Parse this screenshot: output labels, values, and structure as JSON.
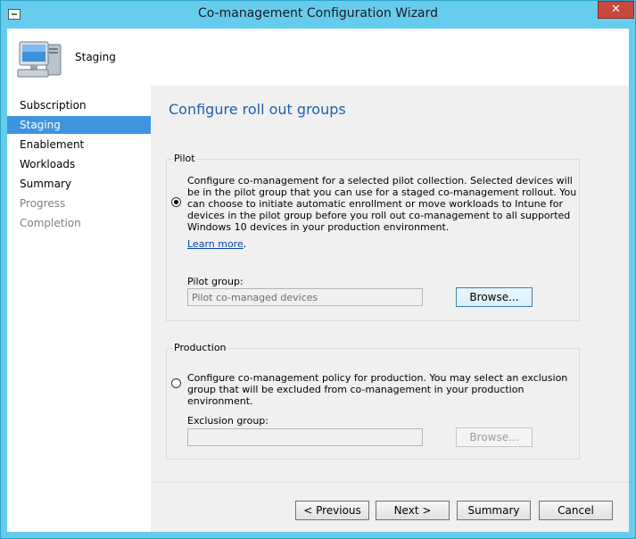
{
  "window": {
    "title": "Co-management Configuration Wizard",
    "close_label": "✕"
  },
  "header": {
    "title": "Staging",
    "icon": "computer-icon"
  },
  "nav": {
    "items": [
      {
        "label": "Subscription",
        "state": "normal"
      },
      {
        "label": "Staging",
        "state": "active"
      },
      {
        "label": "Enablement",
        "state": "normal"
      },
      {
        "label": "Workloads",
        "state": "normal"
      },
      {
        "label": "Summary",
        "state": "normal"
      },
      {
        "label": "Progress",
        "state": "disabled"
      },
      {
        "label": "Completion",
        "state": "disabled"
      }
    ]
  },
  "page": {
    "title": "Configure roll out groups"
  },
  "pilot": {
    "group_label": "Pilot",
    "selected": true,
    "description": "Configure co-management for a selected pilot collection. Selected devices will be in the pilot group that you can use for a staged co-management rollout. You can choose to initiate automatic enrollment or move workloads to Intune for devices in the pilot group before you roll out co-management to all supported Windows 10 devices in your production environment.",
    "learn_more": "Learn more",
    "learn_more_suffix": ".",
    "field_label": "Pilot group:",
    "field_value": "Pilot co-managed devices",
    "browse_label": "Browse..."
  },
  "production": {
    "group_label": "Production",
    "selected": false,
    "description": "Configure co-management policy for production. You may select an exclusion group that will be excluded from co-management in your production environment.",
    "field_label": "Exclusion group:",
    "field_value": "",
    "browse_label": "Browse..."
  },
  "footer": {
    "previous": "< Previous",
    "next": "Next >",
    "summary": "Summary",
    "cancel": "Cancel"
  },
  "colors": {
    "accent": "#3f94df",
    "title_blue": "#1e5fad",
    "frame": "#66ccee",
    "close": "#c7483d"
  }
}
